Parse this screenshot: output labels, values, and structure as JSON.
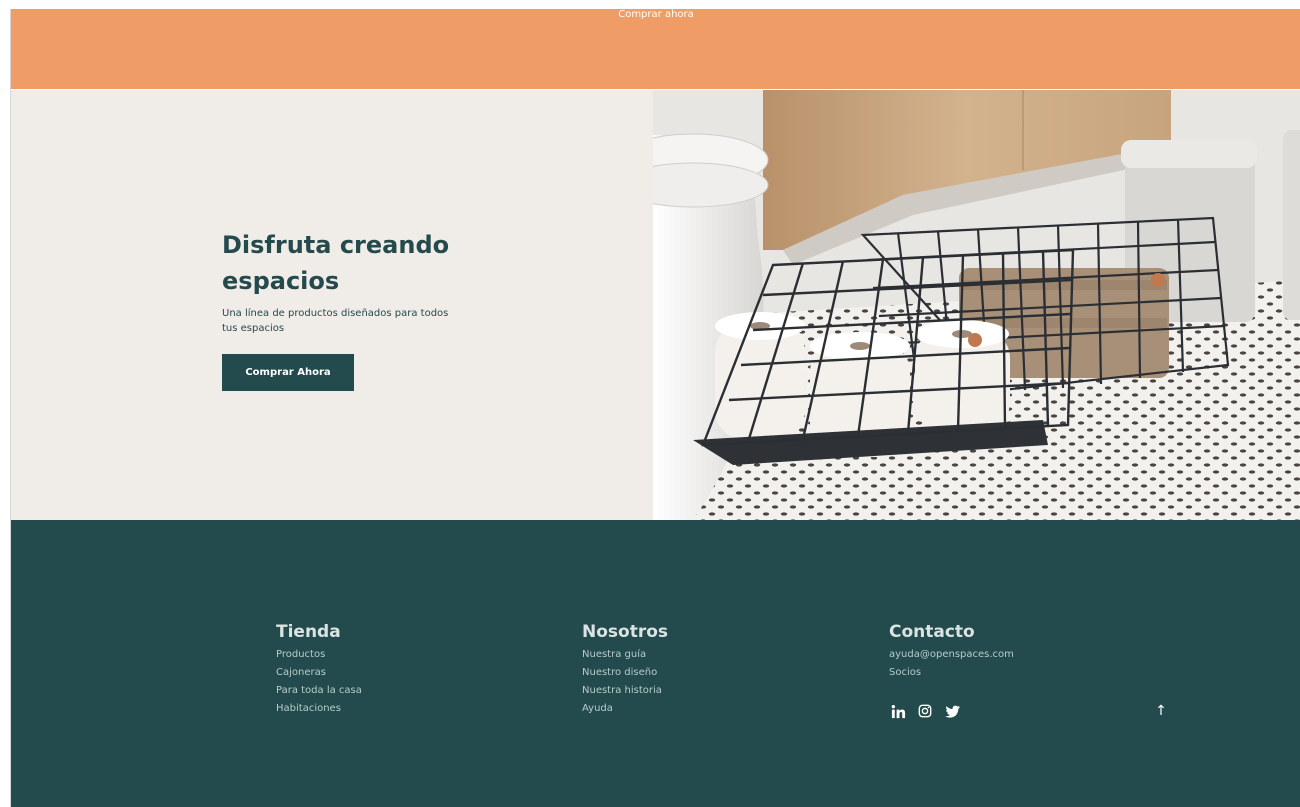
{
  "banner": {
    "link_label": "Comprar ahora",
    "bg_color": "#f09c66"
  },
  "hero": {
    "title": "Disfruta creando espacios",
    "subtitle": "Una línea de productos diseñados para todos tus espacios",
    "cta_label": "Comprar Ahora",
    "image": "bathroom-baskets-photo",
    "bg_color": "#f0ede8",
    "accent_color": "#254a4d"
  },
  "footer": {
    "bg_color": "#234a4c",
    "columns": [
      {
        "title": "Tienda",
        "links": [
          "Productos",
          "Cajoneras",
          "Para toda la casa",
          "Habitaciones"
        ]
      },
      {
        "title": "Nosotros",
        "links": [
          "Nuestra guía",
          "Nuestro diseño",
          "Nuestra historia",
          "Ayuda"
        ]
      },
      {
        "title": "Contacto",
        "links": [
          "ayuda@openspaces.com",
          "Socios"
        ]
      }
    ],
    "social_icons": [
      "linkedin-icon",
      "instagram-icon",
      "twitter-icon"
    ],
    "back_to_top_icon": "arrow-up-icon",
    "back_to_top_glyph": "↑"
  }
}
